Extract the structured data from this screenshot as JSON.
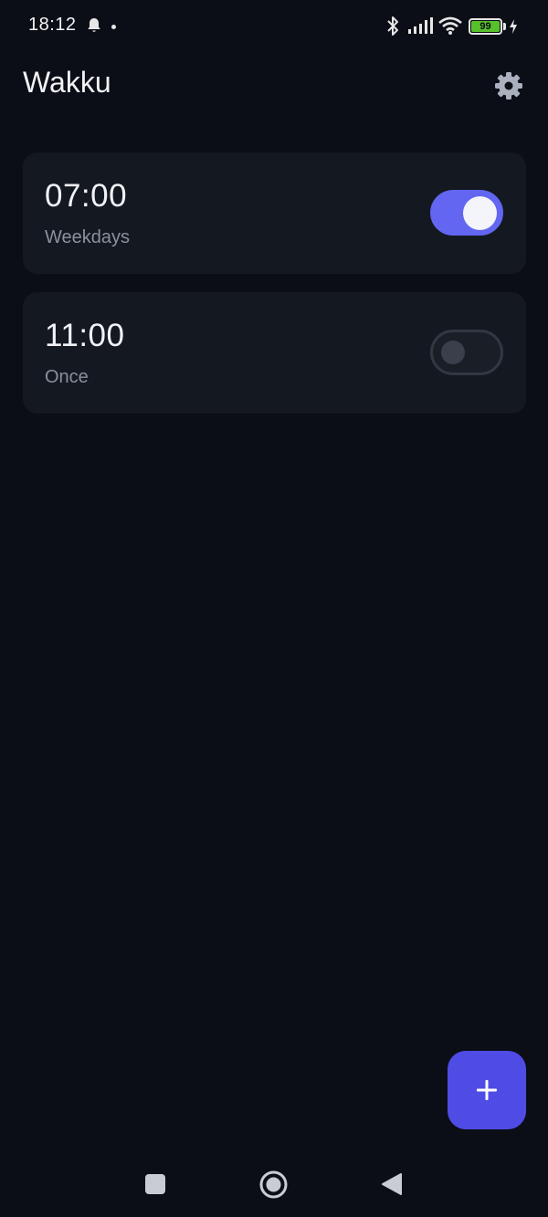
{
  "status_bar": {
    "time": "18:12",
    "battery_level": "99",
    "icons": [
      "bell-icon",
      "dot-icon",
      "bluetooth-icon",
      "signal-icon",
      "wifi-icon",
      "battery-icon",
      "charging-bolt-icon"
    ]
  },
  "app_bar": {
    "title": "Wakku",
    "settings_icon": "gear-icon"
  },
  "alarms": [
    {
      "time": "07:00",
      "repeat": "Weekdays",
      "enabled": true
    },
    {
      "time": "11:00",
      "repeat": "Once",
      "enabled": false
    }
  ],
  "fab": {
    "icon": "plus-icon",
    "color": "#4f4ce6"
  },
  "nav_bar": {
    "icons": [
      "recent-apps-icon",
      "home-icon",
      "back-icon"
    ]
  },
  "colors": {
    "background": "#0b0e16",
    "card": "#141821",
    "accent": "#6266f0",
    "battery": "#58c02a",
    "secondary_text": "#8b909b"
  }
}
